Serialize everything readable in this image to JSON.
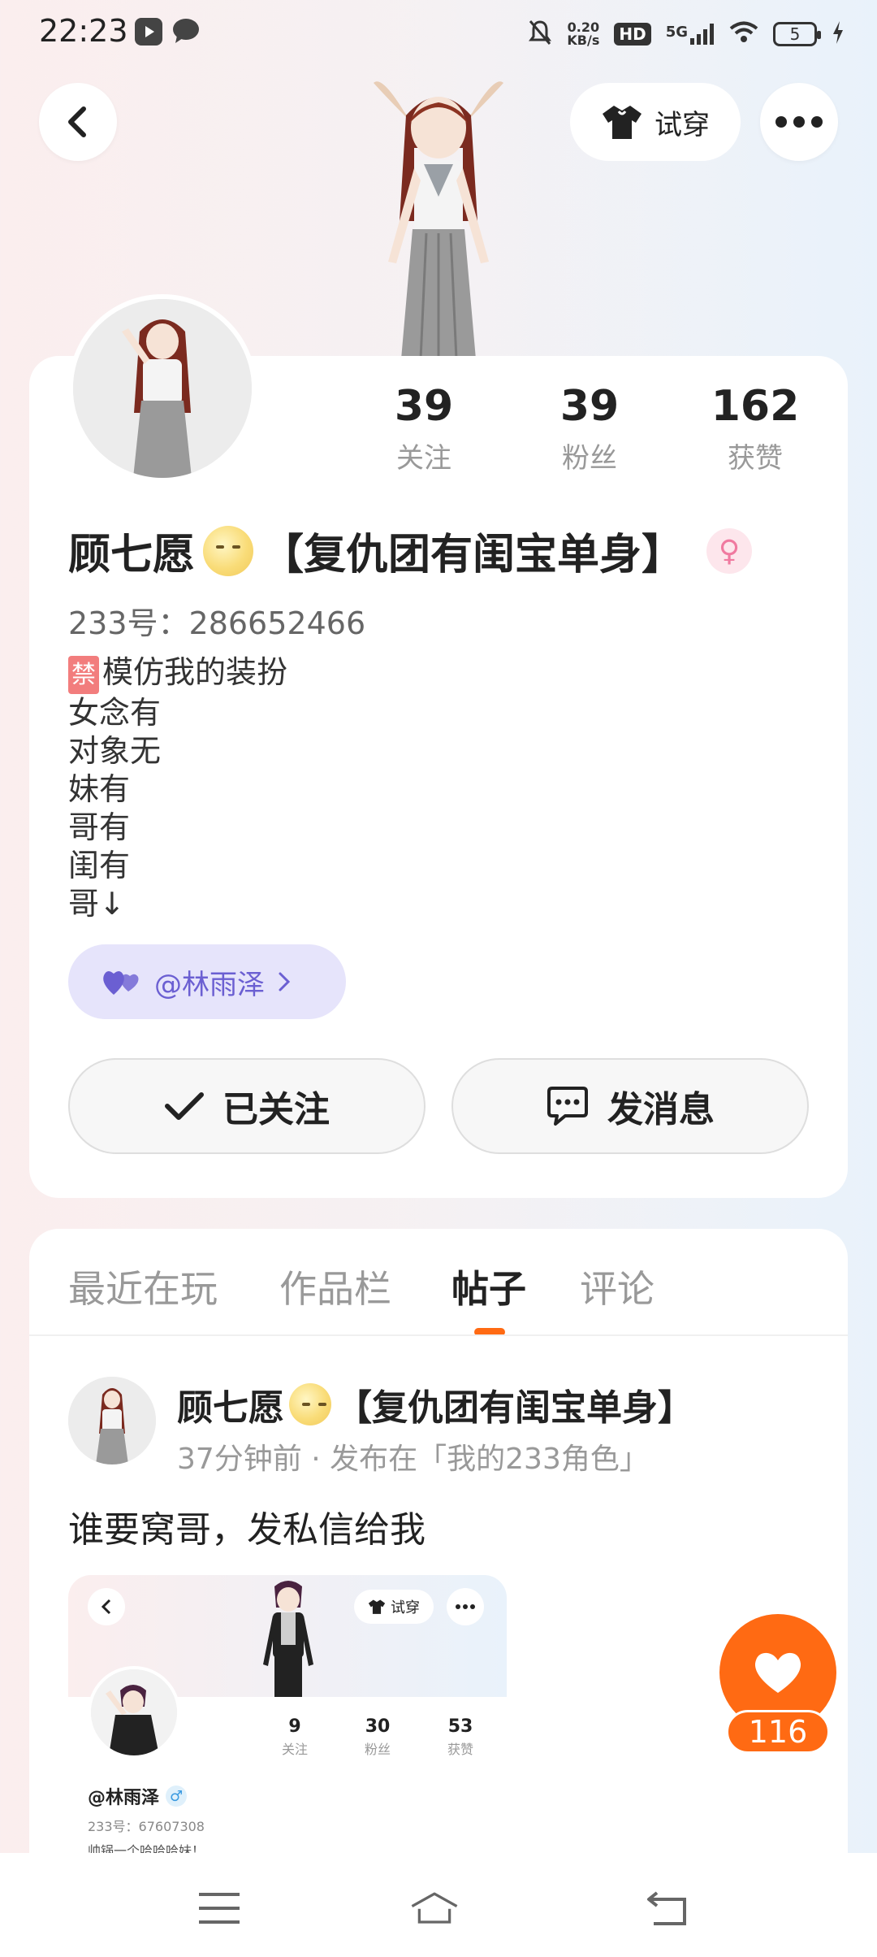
{
  "status_bar": {
    "time": "22:23",
    "net_speed": "0.20",
    "net_unit": "KB/s",
    "hd": "HD",
    "network": "5G",
    "battery": "5"
  },
  "header": {
    "tryon_label": "试穿",
    "icons": [
      "back-icon",
      "tshirt-icon",
      "more-icon"
    ]
  },
  "profile": {
    "stats": [
      {
        "value": "39",
        "label": "关注"
      },
      {
        "value": "39",
        "label": "粉丝"
      },
      {
        "value": "162",
        "label": "获赞"
      }
    ],
    "name_prefix": "顾七愿",
    "name_suffix": "【复仇团有闺宝单身】",
    "gender_symbol": "♀",
    "uid": "233号：286652466",
    "bio_tag": "禁",
    "bio_lines": [
      "模仿我的装扮",
      "女念有",
      "对象无",
      "妹有",
      "哥有",
      "闺有",
      "哥↓"
    ],
    "partner_label": "@林雨泽",
    "follow_button": "已关注",
    "message_button": "发消息"
  },
  "tabs": [
    "最近在玩",
    "作品栏",
    "帖子",
    "评论"
  ],
  "active_tab": "帖子",
  "post": {
    "author_prefix": "顾七愿",
    "author_suffix": "【复仇团有闺宝单身】",
    "meta": "37分钟前 · 发布在「我的233角色」",
    "text": "谁要窝哥，发私信给我",
    "embed": {
      "tryon_label": "试穿",
      "stats": [
        {
          "value": "9",
          "label": "关注"
        },
        {
          "value": "30",
          "label": "粉丝"
        },
        {
          "value": "53",
          "label": "获赞"
        }
      ],
      "name": "@林雨泽",
      "gender_symbol": "♂",
      "uid": "233号：67607308",
      "bio": "帅锅一个哈哈哈妹！"
    }
  },
  "like": {
    "count": "116",
    "color": "#ff6a13"
  },
  "colors": {
    "accent": "#ff6a13",
    "partner": "#6b5fd2",
    "female": "#f07aa0"
  }
}
